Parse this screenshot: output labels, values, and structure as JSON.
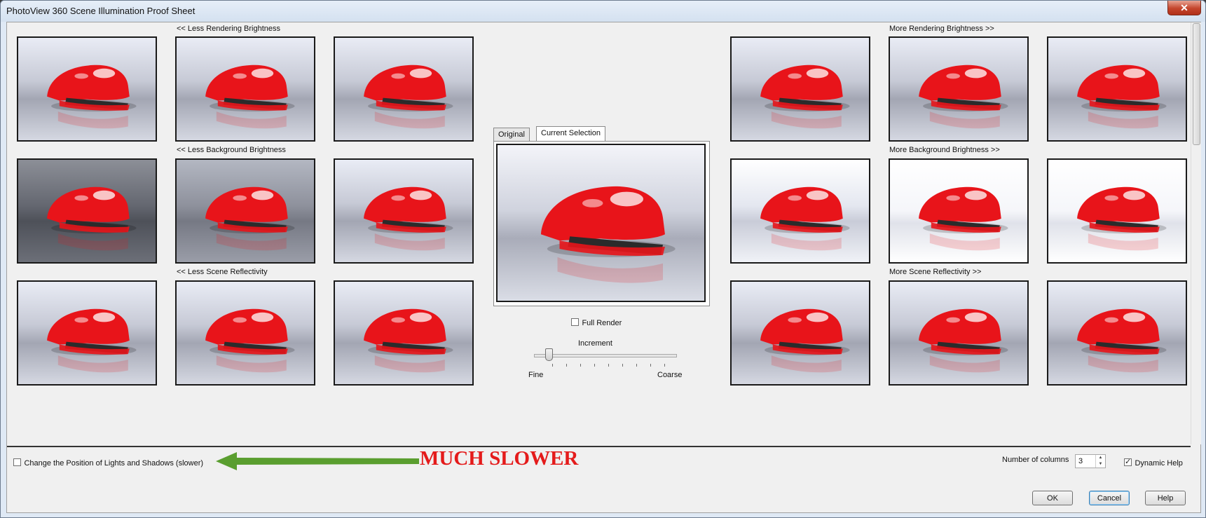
{
  "window": {
    "title": "PhotoView 360 Scene Illumination Proof Sheet",
    "close_glyph": "✕"
  },
  "groups": {
    "less_rendering": "<< Less Rendering Brightness",
    "less_background": "<< Less Background Brightness",
    "less_reflectivity": "<< Less Scene Reflectivity",
    "more_rendering": "More Rendering Brightness >>",
    "more_background": "More Background Brightness >>",
    "more_reflectivity": "More Scene Reflectivity >>"
  },
  "preview": {
    "tabs": [
      {
        "label": "Original",
        "active": false
      },
      {
        "label": "Current Selection",
        "active": true
      }
    ]
  },
  "full_render": {
    "label": "Full Render",
    "checked": false
  },
  "increment": {
    "label": "Increment",
    "min_label": "Fine",
    "max_label": "Coarse",
    "value_fraction": 0.1
  },
  "bottom": {
    "lights_shadows": {
      "label": "Change the Position of Lights and Shadows (slower)",
      "checked": false
    },
    "annotation": "MUCH SLOWER",
    "columns": {
      "label": "Number of columns",
      "value": "3"
    },
    "dynamic_help": {
      "label": "Dynamic Help",
      "checked": true
    },
    "ok": "OK",
    "cancel": "Cancel",
    "help": "Help"
  },
  "colors": {
    "annotation_red": "#e41b1b",
    "arrow_green": "#5a9e2f",
    "stapler_red": "#e8141a"
  },
  "icons": {
    "spin_up": "▲",
    "spin_down": "▼"
  }
}
